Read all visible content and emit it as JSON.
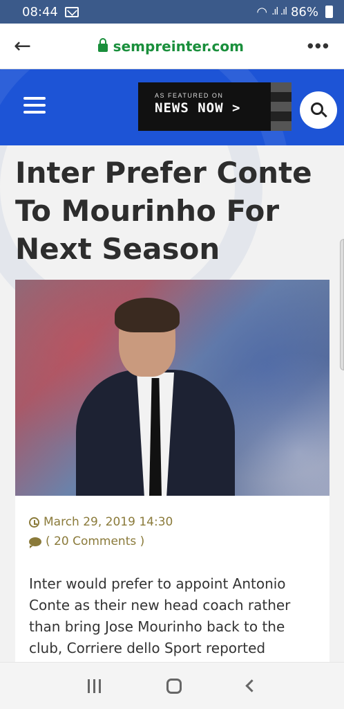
{
  "status_bar": {
    "time": "08:44",
    "battery": "86%",
    "signal": ".ıl .ıl"
  },
  "browser": {
    "url": "sempreinter.com"
  },
  "header": {
    "newsnow_small": "AS FEATURED ON",
    "newsnow_big": "NEWS NOW >"
  },
  "article": {
    "title": "Inter Prefer Conte To Mourinho For Next Season",
    "date": "March 29, 2019 14:30",
    "comments": "( 20 Comments )",
    "body": "Inter would prefer to appoint Antonio Conte as their new head coach rather than bring Jose Mourinho back to the club, Corriere dello Sport reported"
  },
  "colors": {
    "header_blue": "#1d54d6",
    "status_bar": "#3b5a8a",
    "url_green": "#1a8f3c",
    "meta_gold": "#8a7a3a"
  }
}
